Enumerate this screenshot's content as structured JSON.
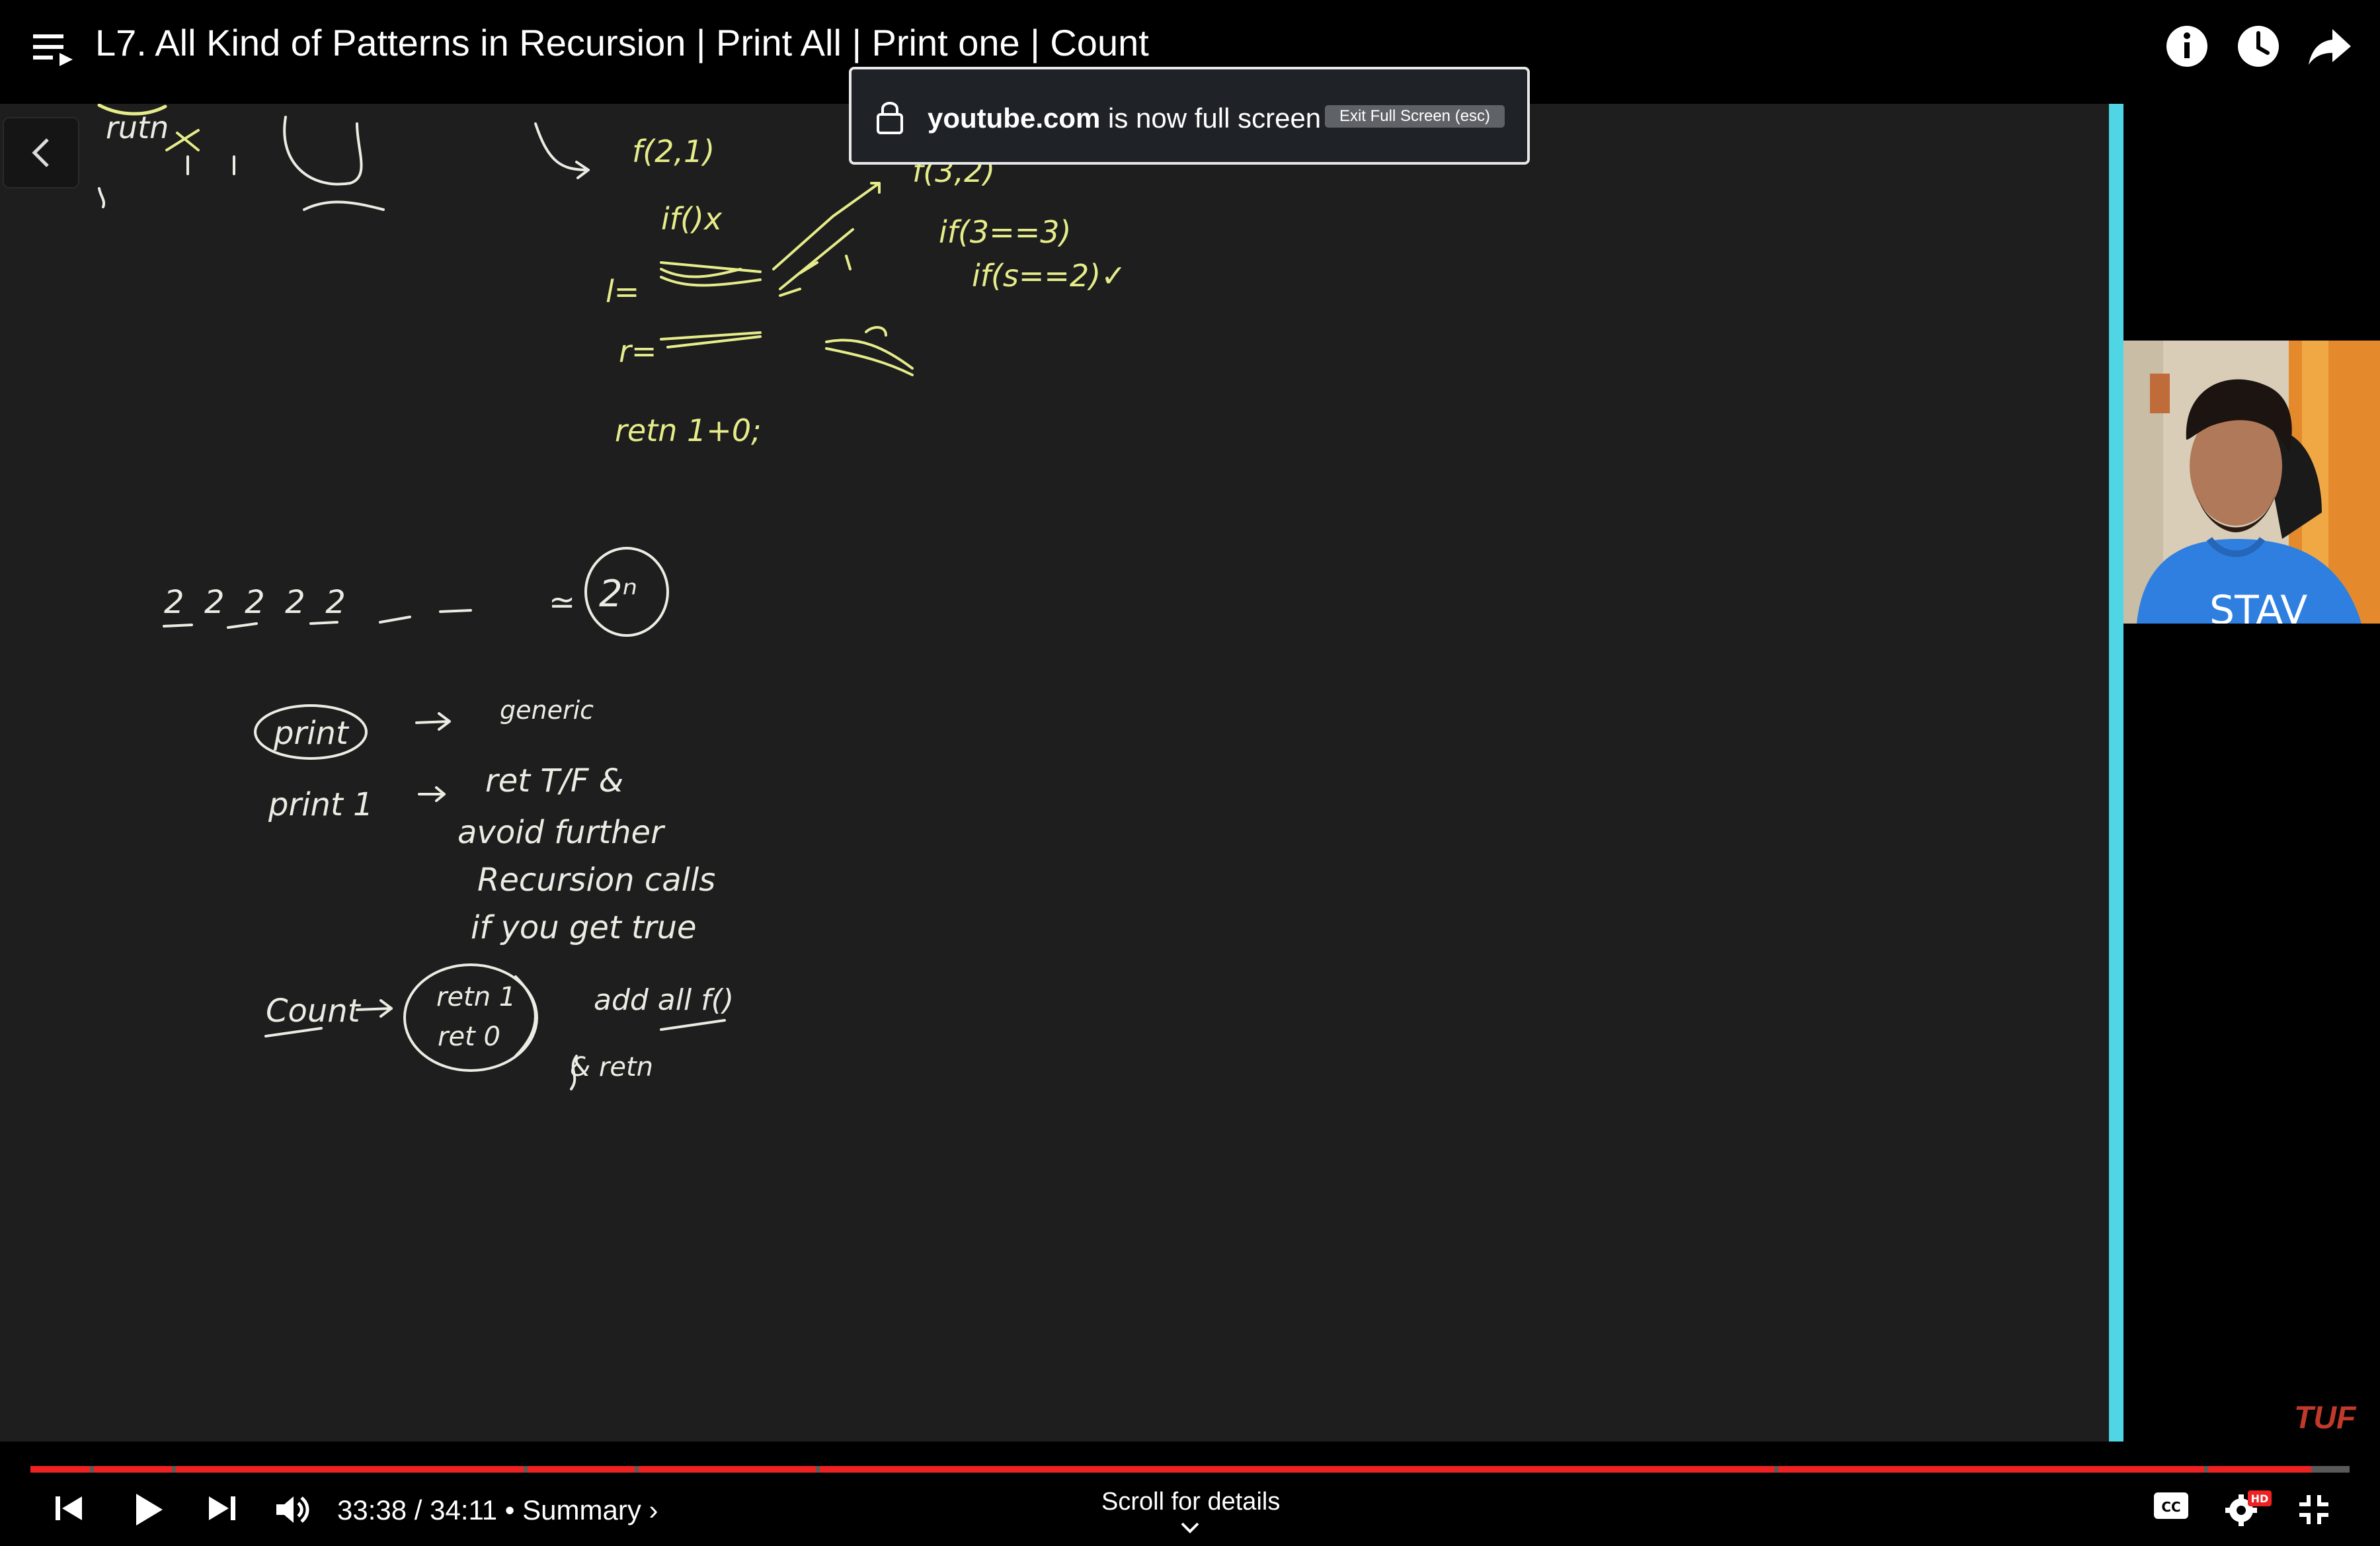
{
  "header": {
    "title": "L7. All Kind of Patterns in Recursion | Print All | Print one | Count"
  },
  "notice": {
    "host": "youtube.com",
    "message": "is now full screen",
    "button": "Exit Full Screen (esc)"
  },
  "player": {
    "time": "33:38 / 34:11",
    "chapter": "• Summary ›",
    "scroll_hint": "Scroll for details",
    "watermark": "TUF",
    "progress": 0.985,
    "hd_badge": "HD"
  },
  "whiteboard": {
    "tl_text": "rutn",
    "f21": "f(2,1)",
    "f32": "f(3,2)",
    "if1": "if()x",
    "if2": "if(3==3)",
    "if3": "if(s==2)✓",
    "l_eq": "l=",
    "r_eq": "r=",
    "ret": "retn 1+0;",
    "twos": "2  2  2  2  2",
    "approx": "≃",
    "pow": "2ⁿ",
    "print_lbl": "print",
    "print_txt": "generic",
    "print1_lbl": "print 1",
    "ret_tf": "ret T/F &",
    "avoid": "avoid further",
    "rec_calls": "Recursion calls",
    "if_true": "if you get true",
    "count_lbl": "Count",
    "ret1": "retn 1",
    "ret0": "ret 0",
    "add_all": "add all f()",
    "return": "& retn"
  },
  "colors": {
    "accent_red": "#e22222",
    "chalk_yellow": "#e6ec8a",
    "chalk_white": "#ecece4",
    "cyan_bar": "#4fd5e4"
  },
  "icons": [
    "playlist-icon",
    "info-icon",
    "clock-icon",
    "share-icon",
    "lock-icon",
    "back-chevron-icon",
    "prev-icon",
    "play-icon",
    "next-icon",
    "volume-icon",
    "cc-icon",
    "settings-icon",
    "exit-fullscreen-icon",
    "chevron-down-icon"
  ]
}
